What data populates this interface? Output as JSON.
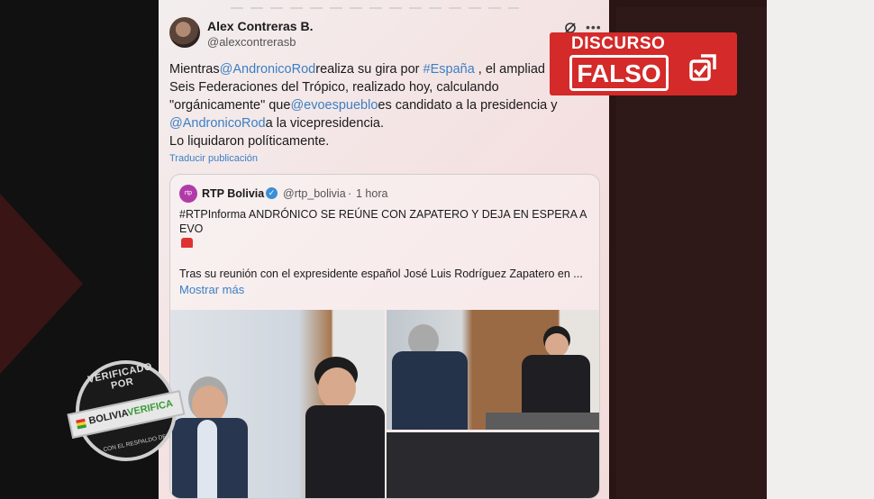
{
  "tweet": {
    "author_name": "Alex Contreras B.",
    "author_handle": "@alexcontrerasb",
    "text_parts": {
      "p1": "Mientras",
      "m1": "@AndronicoRod",
      "p2": "realiza su gira por ",
      "m2": "#España",
      "p3": " , el ampliad",
      "p4": "Seis Federaciones del Trópico, realizado hoy, calculando",
      "p5": "\"orgánicamente\" que",
      "m3": "@evoespueblo",
      "p6": "es candidato a la presidencia y",
      "m4": "@AndronicoRod",
      "p7": "a la vicepresidencia.",
      "p8": "Lo liquidaron políticamente."
    },
    "translate_label": "Traducir publicación"
  },
  "quoted": {
    "avatar_label": "rtp",
    "name": "RTP Bolivia",
    "handle": "@rtp_bolivia",
    "separator": "·",
    "time": "1 hora",
    "line1": "#RTPInforma ANDRÓNICO SE REÚNE CON ZAPATERO Y DEJA EN ESPERA A EVO",
    "line2": "Tras su reunión con el expresidente español José Luis Rodríguez Zapatero en ...",
    "show_more": "Mostrar más"
  },
  "badge": {
    "top": "DISCURSO",
    "main": "FALSO"
  },
  "stamp": {
    "top": "VERIFICADO POR",
    "brand_a": "BOLIVIA",
    "brand_b": "VERIFICA",
    "bottom": "CON EL RESPALDO DE"
  },
  "icons": [
    "grok-icon",
    "more-options-icon",
    "verified-icon",
    "siren-icon",
    "check-icon"
  ],
  "colors": {
    "link": "#3a7fc4",
    "badge_red": "#d42a2a",
    "background_dark": "#141414"
  }
}
